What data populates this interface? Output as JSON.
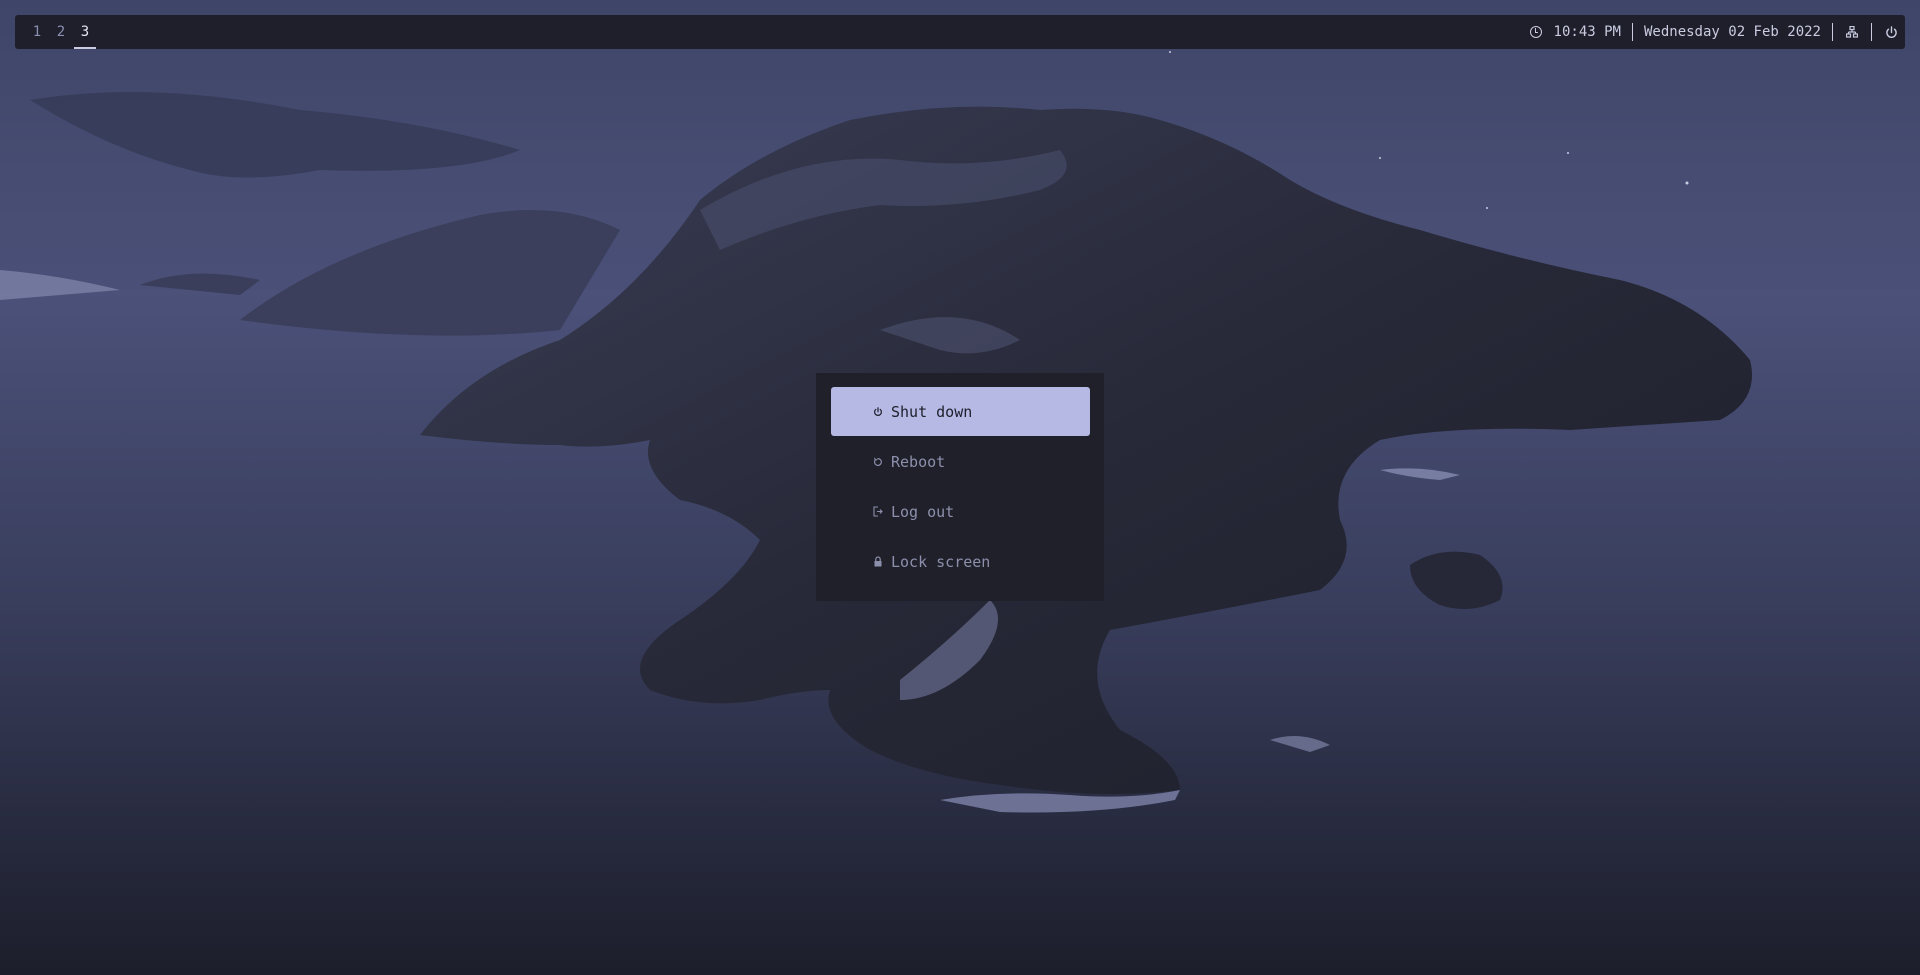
{
  "topbar": {
    "workspaces": [
      "1",
      "2",
      "3"
    ],
    "active_workspace": "3",
    "time": "10:43 PM",
    "date": "Wednesday 02 Feb 2022",
    "icons": [
      "clock-icon",
      "network-icon",
      "power-icon"
    ]
  },
  "power_menu": {
    "items": [
      {
        "label": "Shut down",
        "icon": "power-icon",
        "selected": true
      },
      {
        "label": "Reboot",
        "icon": "reboot-icon",
        "selected": false
      },
      {
        "label": "Log out",
        "icon": "logout-icon",
        "selected": false
      },
      {
        "label": "Lock screen",
        "icon": "lock-icon",
        "selected": false
      }
    ]
  },
  "colors": {
    "bar_bg": "#1e1f2b",
    "menu_bg": "#1f2029",
    "accent": "#b5b9e4",
    "text": "#c9cbe0",
    "muted_text": "#8d90ad"
  }
}
